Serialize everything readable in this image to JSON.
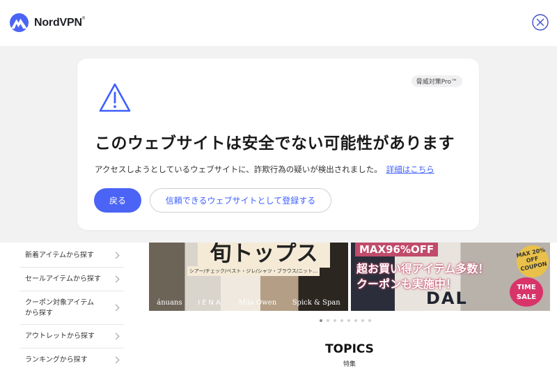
{
  "brand": {
    "name": "NordVPN",
    "trademark": "®",
    "logo_icon": "nordvpn-mountain-logo"
  },
  "close_icon": "close-circle-icon",
  "warning": {
    "badge": "脅威対策Pro™",
    "icon": "warning-triangle-icon",
    "headline": "このウェブサイトは安全でない可能性があります",
    "description": "アクセスしようとしているウェブサイトに、詐欺行為の疑いが検出されました。",
    "details_link": "詳細はこちら",
    "back_button": "戻る",
    "trust_button": "信頼できるウェブサイトとして登録する"
  },
  "colors": {
    "accent": "#4b64f5",
    "link": "#3e5fff",
    "overlay_bg": "#f2f2f2",
    "warning_icon": "#3e5fff"
  },
  "site": {
    "side_nav": [
      {
        "label": "新着アイテムから探す"
      },
      {
        "label": "セールアイテムから探す"
      },
      {
        "label": "クーポン対象アイテム\nから探す"
      },
      {
        "label": "アウトレットから探す"
      },
      {
        "label": "ランキングから探す"
      }
    ],
    "banner_a": {
      "title": "旬トップス",
      "subtitle": "シアー/チェック/ベスト・ジレ/シャツ・ブラウス/ニット…",
      "brands": [
        "ánuans",
        "IENA",
        "Mila Owen",
        "Spick & Span"
      ]
    },
    "banner_b": {
      "headline": "MAX96%OFF",
      "line1": "超お買い得アイテム多数！",
      "line2": "クーポンも実施中！",
      "coupon": "MAX 20% OFF COUPON",
      "time_sale": "TIME SALE",
      "logo": "DAL"
    },
    "carousel": {
      "count": 8,
      "active": 1
    },
    "topics": {
      "title": "TOPICS",
      "subtitle": "特集"
    }
  }
}
